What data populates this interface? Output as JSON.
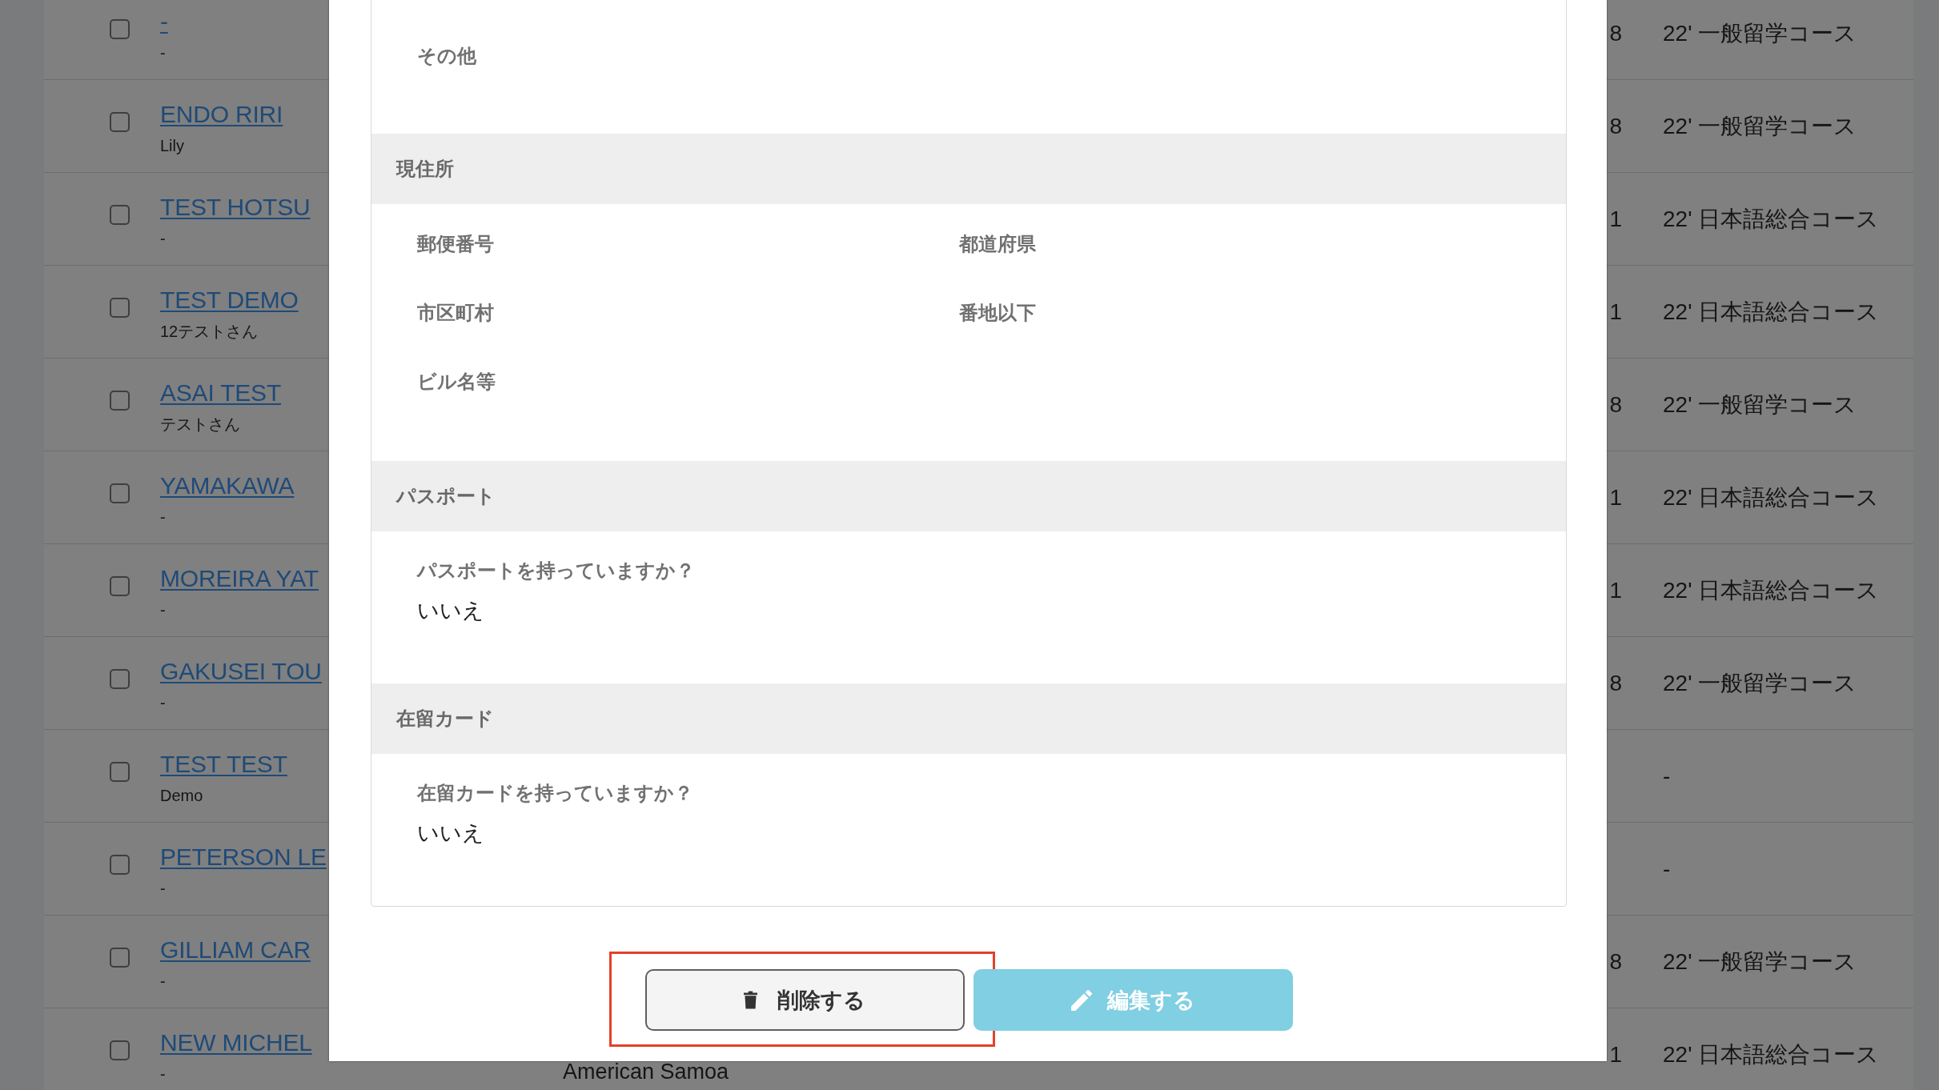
{
  "students": [
    {
      "checked": false,
      "name": "-",
      "alias": "-",
      "date": "8",
      "course": "22' 一般留学コース"
    },
    {
      "checked": false,
      "name": "ENDO RIRI",
      "alias": "Lily",
      "date": "8",
      "course": "22' 一般留学コース"
    },
    {
      "checked": false,
      "name": "TEST HOTSU",
      "alias": "-",
      "date": "1",
      "course": "22' 日本語総合コース"
    },
    {
      "checked": false,
      "name": "TEST DEMO",
      "alias": "12テストさん",
      "date": "1",
      "course": "22' 日本語総合コース"
    },
    {
      "checked": false,
      "name": "ASAI TEST",
      "alias": "テストさん",
      "date": "8",
      "course": "22' 一般留学コース"
    },
    {
      "checked": false,
      "name": "YAMAKAWA",
      "alias": "-",
      "date": "1",
      "course": "22' 日本語総合コース"
    },
    {
      "checked": false,
      "name": "MOREIRA YAT",
      "alias": "-",
      "date": "1",
      "course": "22' 日本語総合コース"
    },
    {
      "checked": false,
      "name": "GAKUSEI TOU",
      "alias": "-",
      "date": "8",
      "course": "22' 一般留学コース"
    },
    {
      "checked": false,
      "name": "TEST TEST",
      "alias": "Demo",
      "course": "-"
    },
    {
      "checked": false,
      "name": "PETERSON LE",
      "alias": "-",
      "course": "-"
    },
    {
      "checked": false,
      "name": "GILLIAM CAR",
      "alias": "-",
      "date": "8",
      "course": "22' 一般留学コース"
    },
    {
      "checked": false,
      "name": "NEW MICHEL",
      "alias": "-",
      "country": "American Samoa",
      "date": "1",
      "course": "22' 日本語総合コース"
    }
  ],
  "dialog": {
    "top_fields": [
      {
        "label": "その他"
      }
    ],
    "sections": [
      {
        "title": "現住所",
        "kind": "grid",
        "fields": [
          {
            "label": "郵便番号"
          },
          {
            "label": "都道府県"
          },
          {
            "label": "市区町村"
          },
          {
            "label": "番地以下"
          },
          {
            "label": "ビル名等"
          }
        ]
      },
      {
        "title": "パスポート",
        "kind": "stack",
        "fields": [
          {
            "label": "パスポートを持っていますか？",
            "value": "いいえ"
          }
        ]
      },
      {
        "title": "在留カード",
        "kind": "stack",
        "fields": [
          {
            "label": "在留カードを持っていますか？",
            "value": "いいえ"
          }
        ]
      }
    ],
    "buttons": [
      {
        "kind": "delete",
        "label": "削除する",
        "highlighted": true
      },
      {
        "kind": "edit",
        "label": "編集する",
        "highlighted": false
      }
    ]
  }
}
